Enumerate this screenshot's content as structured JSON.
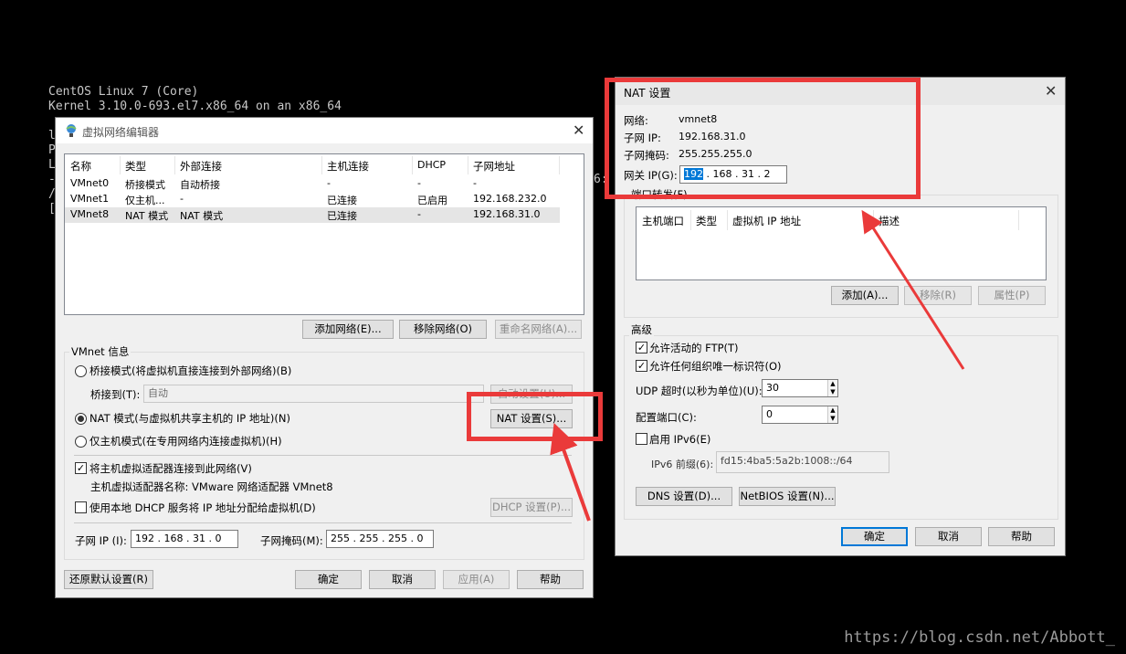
{
  "terminal": {
    "lines": [
      "CentOS Linux 7 (Core)",
      "Kernel 3.10.0-693.el7.x86_64 on an x86_64"
    ],
    "frag1": "l",
    "frag2": "P",
    "frag3": "L",
    "frag4": "-",
    "frag5": "/",
    "frag6": "[",
    "frag7": "6:"
  },
  "watermark": "https://blog.csdn.net/Abbott_",
  "vne": {
    "title": "虚拟网络编辑器",
    "columns": [
      "名称",
      "类型",
      "外部连接",
      "主机连接",
      "DHCP",
      "子网地址"
    ],
    "rows": [
      [
        "VMnet0",
        "桥接模式",
        "自动桥接",
        "-",
        "-",
        "-"
      ],
      [
        "VMnet1",
        "仅主机...",
        "-",
        "已连接",
        "已启用",
        "192.168.232.0"
      ],
      [
        "VMnet8",
        "NAT 模式",
        "NAT 模式",
        "已连接",
        "-",
        "192.168.31.0"
      ]
    ],
    "add_network": "添加网络(E)...",
    "remove_network": "移除网络(O)",
    "rename_network": "重命名网络(A)...",
    "vmnet_info": "VMnet 信息",
    "bridge_mode": "桥接模式(将虚拟机直接连接到外部网络)(B)",
    "bridge_to_label": "桥接到(T):",
    "bridge_to_value": "自动",
    "auto_settings": "自动设置(U)...",
    "nat_mode": "NAT 模式(与虚拟机共享主机的 IP 地址)(N)",
    "nat_settings": "NAT 设置(S)...",
    "host_only": "仅主机模式(在专用网络内连接虚拟机)(H)",
    "connect_adapter": "将主机虚拟适配器连接到此网络(V)",
    "adapter_name": "主机虚拟适配器名称: VMware 网络适配器 VMnet8",
    "use_dhcp": "使用本地 DHCP 服务将 IP 地址分配给虚拟机(D)",
    "dhcp_settings": "DHCP 设置(P)...",
    "subnet_ip_label": "子网 IP (I):",
    "subnet_ip": "192 . 168 . 31 . 0",
    "subnet_mask_label": "子网掩码(M):",
    "subnet_mask": "255 . 255 . 255 . 0",
    "restore_defaults": "还原默认设置(R)",
    "ok": "确定",
    "cancel": "取消",
    "apply": "应用(A)",
    "help": "帮助"
  },
  "nat": {
    "title": "NAT 设置",
    "network_label": "网络:",
    "network_value": "vmnet8",
    "subnet_ip_label": "子网 IP:",
    "subnet_ip_value": "192.168.31.0",
    "subnet_mask_label": "子网掩码:",
    "subnet_mask_value": "255.255.255.0",
    "gateway_label": "网关 IP(G):",
    "gateway_first": "192",
    "gateway_rest": ". 168 . 31 . 2",
    "port_forward": "端口转发(F)",
    "pf_columns": [
      "主机端口",
      "类型",
      "虚拟机 IP 地址",
      "描述"
    ],
    "add": "添加(A)...",
    "remove": "移除(R)",
    "properties": "属性(P)",
    "advanced": "高级",
    "allow_ftp": "允许活动的 FTP(T)",
    "allow_oui": "允许任何组织唯一标识符(O)",
    "udp_timeout_label": "UDP 超时(以秒为单位)(U):",
    "udp_timeout": "30",
    "config_port_label": "配置端口(C):",
    "config_port": "0",
    "enable_ipv6": "启用 IPv6(E)",
    "ipv6_prefix_label": "IPv6 前缀(6):",
    "ipv6_prefix": "fd15:4ba5:5a2b:1008::/64",
    "dns": "DNS 设置(D)...",
    "netbios": "NetBIOS 设置(N)...",
    "ok": "确定",
    "cancel": "取消",
    "help": "帮助"
  },
  "colors": {
    "annotation_red": "#ea3a3a",
    "selection_blue": "#0078d7"
  }
}
